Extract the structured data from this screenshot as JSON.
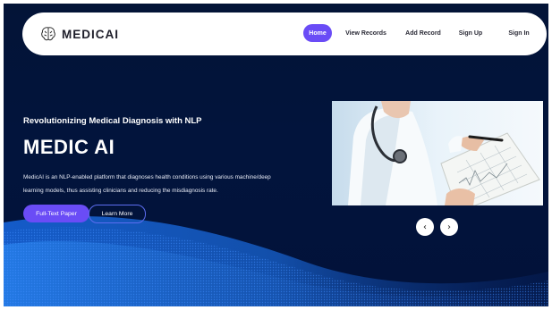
{
  "brand": {
    "logo_text": "MEDICAI",
    "logo_icon": "brain-icon"
  },
  "nav": {
    "items": [
      {
        "label": "Home",
        "active": true
      },
      {
        "label": "View Records"
      },
      {
        "label": "Add Record"
      },
      {
        "label": "Sign Up"
      },
      {
        "label": "Sign In"
      }
    ]
  },
  "hero": {
    "subtitle": "Revolutionizing Medical Diagnosis with NLP",
    "title": "MEDIC AI",
    "description": "MedicAI is an NLP-enabled platform that diagnoses health conditions using various machine/deep learning models, thus assisting clinicians and reducing the misdiagnosis rate.",
    "primary_button": "Full-Text Paper",
    "secondary_button": "Learn More"
  },
  "carousel": {
    "prev_icon": "chevron-left-icon",
    "next_icon": "chevron-right-icon",
    "prev_glyph": "‹",
    "next_glyph": "›"
  },
  "colors": {
    "accent": "#6a4cf6",
    "background": "#02143c",
    "wave": "#1d6fe0"
  }
}
